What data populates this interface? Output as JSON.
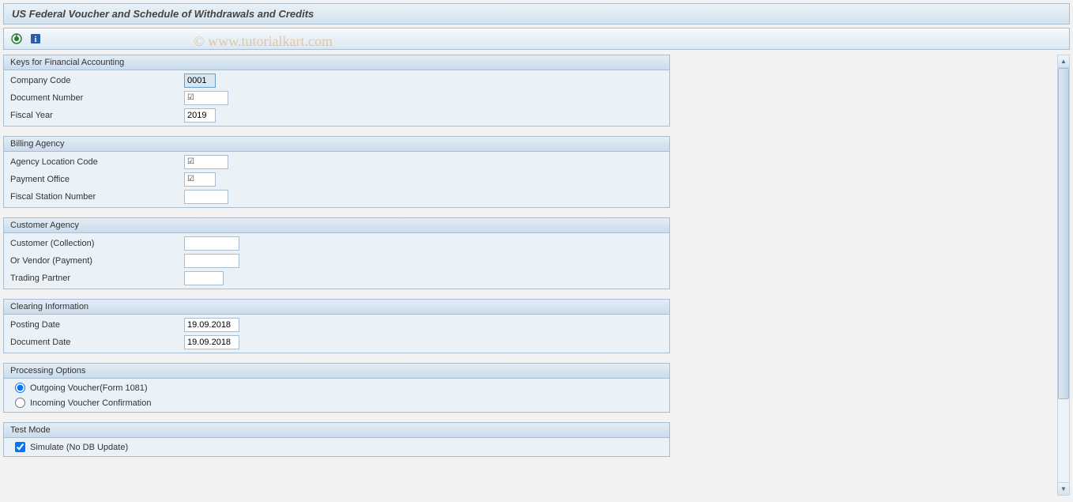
{
  "title": "US Federal Voucher and Schedule of Withdrawals and Credits",
  "watermark": "© www.tutorialkart.com",
  "toolbar": {
    "execute_icon": "execute",
    "info_icon": "info"
  },
  "panels": {
    "keys": {
      "title": "Keys for Financial Accounting",
      "company_code_label": "Company Code",
      "company_code_value": "0001",
      "document_number_label": "Document Number",
      "document_number_value": "☑",
      "fiscal_year_label": "Fiscal Year",
      "fiscal_year_value": "2019"
    },
    "billing": {
      "title": "Billing Agency",
      "agency_location_label": "Agency Location Code",
      "agency_location_value": "☑",
      "payment_office_label": "Payment Office",
      "payment_office_value": "☑",
      "fiscal_station_label": "Fiscal Station Number",
      "fiscal_station_value": ""
    },
    "customer": {
      "title": "Customer Agency",
      "customer_label": "Customer (Collection)",
      "customer_value": "",
      "vendor_label": "Or Vendor (Payment)",
      "vendor_value": "",
      "trading_label": "Trading Partner",
      "trading_value": ""
    },
    "clearing": {
      "title": "Clearing Information",
      "posting_date_label": "Posting Date",
      "posting_date_value": "19.09.2018",
      "document_date_label": "Document Date",
      "document_date_value": "19.09.2018"
    },
    "processing": {
      "title": "Processing Options",
      "outgoing_label": "Outgoing Voucher(Form 1081)",
      "incoming_label": "Incoming Voucher Confirmation"
    },
    "testmode": {
      "title": "Test Mode",
      "simulate_label": "Simulate (No DB Update)"
    }
  }
}
